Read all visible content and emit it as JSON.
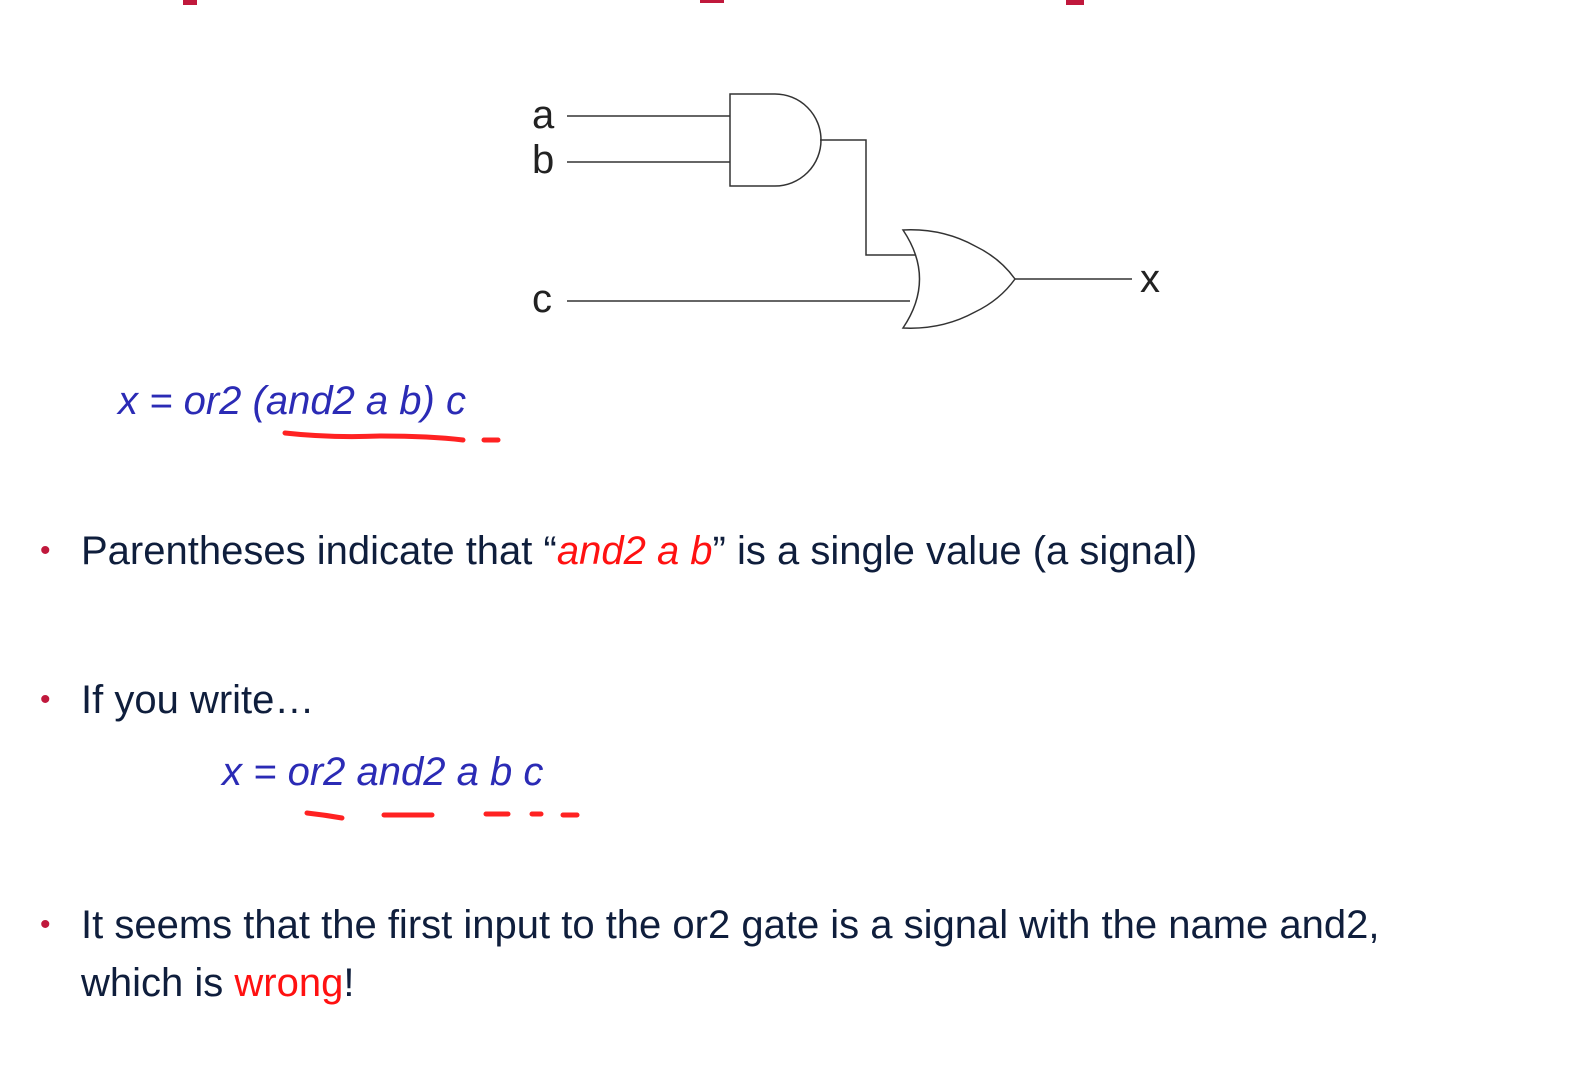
{
  "diagram": {
    "inputs": {
      "a": "a",
      "b": "b",
      "c": "c"
    },
    "output": "x",
    "gates": [
      {
        "type": "and2",
        "inputs": [
          "a",
          "b"
        ]
      },
      {
        "type": "or2",
        "inputs": [
          "and2-out",
          "c"
        ]
      }
    ]
  },
  "formula1": {
    "prefix": "x = or2 (and2 a b) c"
  },
  "bullets": [
    {
      "text_before": "Parentheses indicate that “",
      "highlight": "and2 a b",
      "text_after": "” is a single value (a signal)"
    },
    {
      "text": "If you write…"
    },
    {
      "line1": "It seems that the first input to the or2 gate is a signal with the name and2,",
      "line2_before": "which is ",
      "line2_highlight": "wrong",
      "line2_after": "!"
    }
  ],
  "formula2": {
    "text": "x = or2 and2 a b c"
  },
  "bullet_glyph": "•",
  "colors": {
    "formula": "#2b2bb5",
    "highlight": "#ff1111",
    "bullet": "#c0183c",
    "body_text": "#0f1e3c",
    "title": "#c0183c"
  }
}
